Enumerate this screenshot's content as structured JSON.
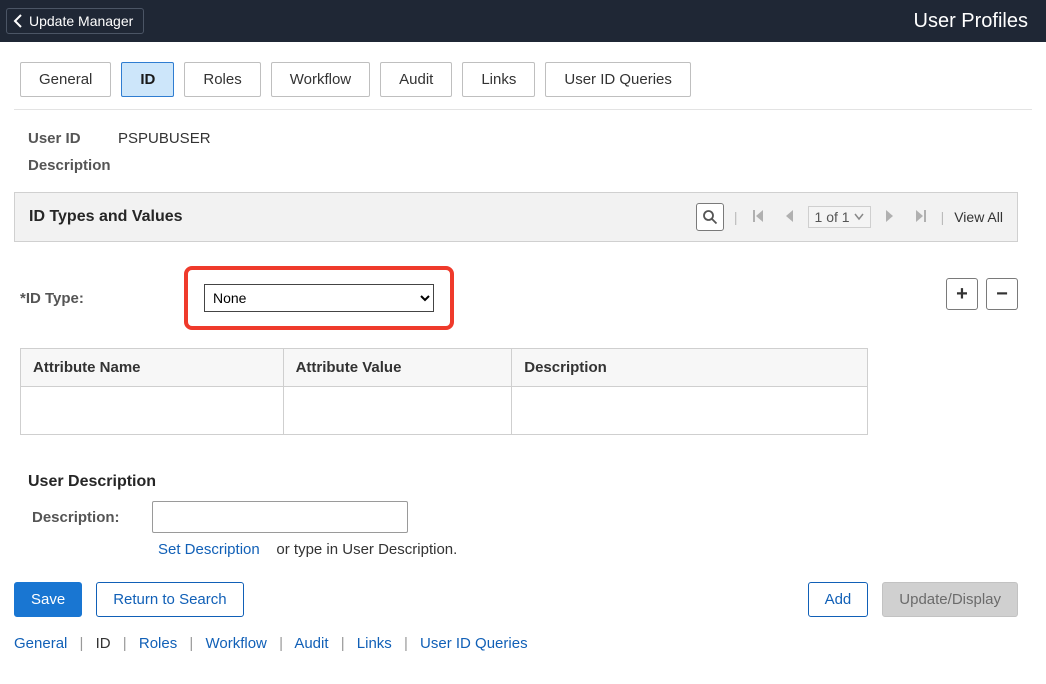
{
  "topbar": {
    "back_label": "Update Manager",
    "title": "User Profiles"
  },
  "tabs": {
    "general": "General",
    "id": "ID",
    "roles": "Roles",
    "workflow": "Workflow",
    "audit": "Audit",
    "links": "Links",
    "user_id_queries": "User ID Queries"
  },
  "info": {
    "user_id_label": "User ID",
    "user_id_value": "PSPUBUSER",
    "description_label": "Description"
  },
  "grid": {
    "title": "ID Types and Values",
    "page_text": "1 of 1",
    "view_all": "View All"
  },
  "id_type": {
    "label": "*ID Type:",
    "selected": "None"
  },
  "attr_table": {
    "col_name": "Attribute Name",
    "col_value": "Attribute Value",
    "col_desc": "Description"
  },
  "user_desc_section": {
    "title": "User Description",
    "field_label": "Description:",
    "value": "",
    "set_link": "Set Description",
    "hint": "or type in User Description."
  },
  "buttons": {
    "save": "Save",
    "return": "Return to Search",
    "add": "Add",
    "update": "Update/Display"
  },
  "footer": {
    "general": "General",
    "id": "ID",
    "roles": "Roles",
    "workflow": "Workflow",
    "audit": "Audit",
    "links": "Links",
    "user_id_queries": "User ID Queries"
  }
}
